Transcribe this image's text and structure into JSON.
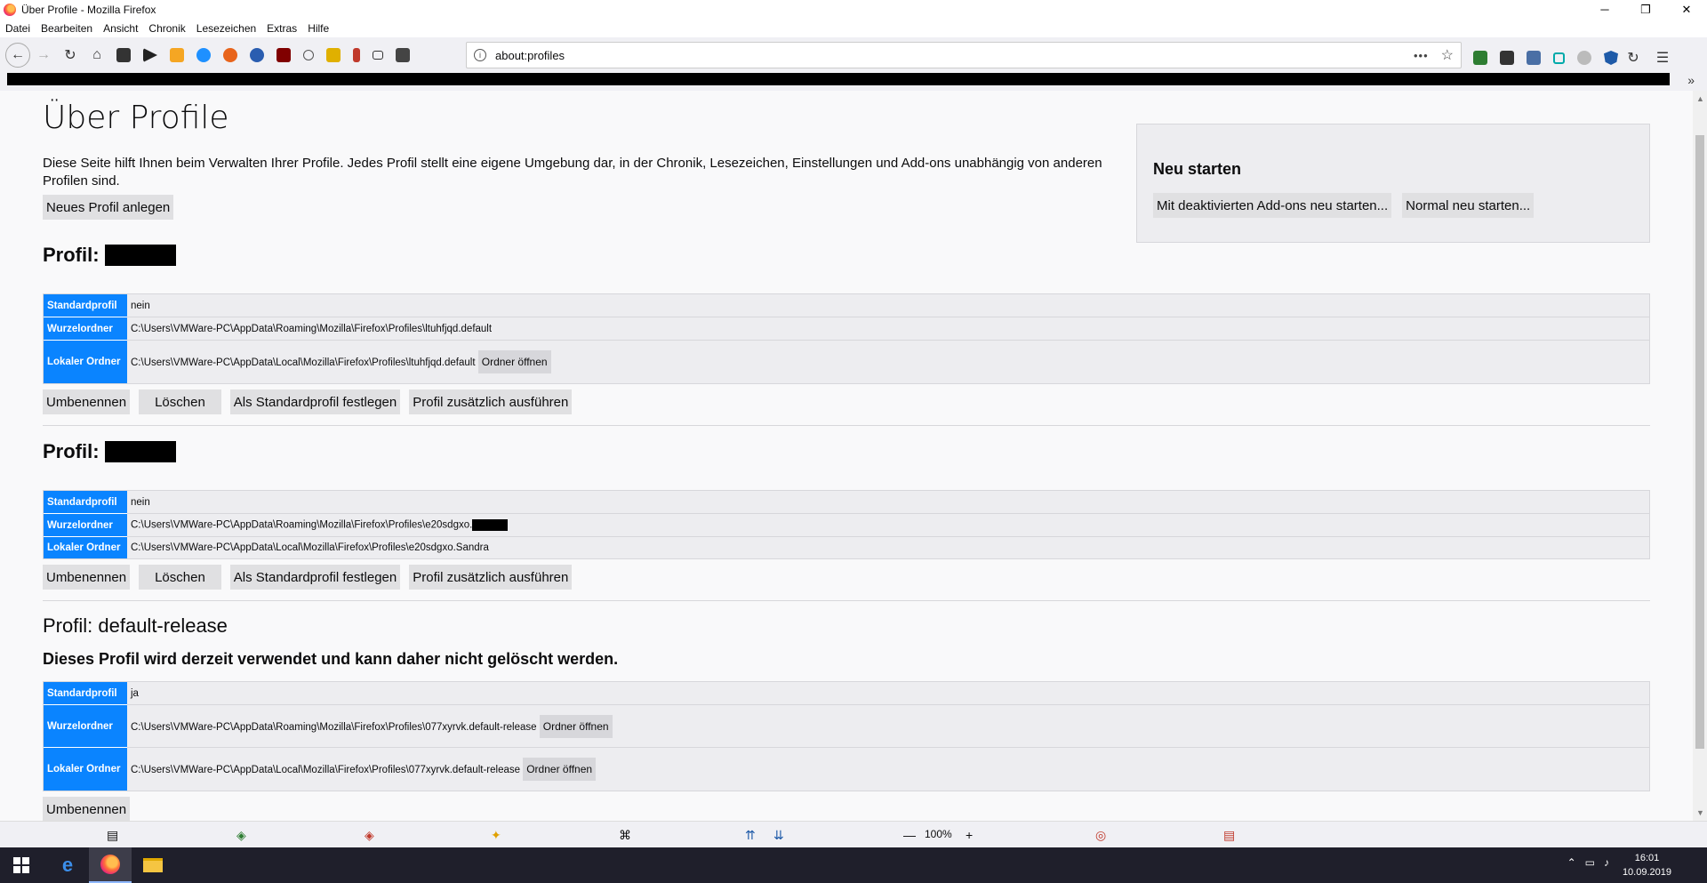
{
  "window": {
    "title": "Über Profile - Mozilla Firefox",
    "minimize": "─",
    "maximize": "❐",
    "close": "✕"
  },
  "menu": [
    "Datei",
    "Bearbeiten",
    "Ansicht",
    "Chronik",
    "Lesezeichen",
    "Extras",
    "Hilfe"
  ],
  "urlbar": {
    "url": "about:profiles",
    "info_glyph": "i",
    "more_glyph": "•••",
    "star_glyph": "☆"
  },
  "nav_icons": [
    "back-icon",
    "forward-icon",
    "reload-icon",
    "home-icon",
    "bookmark-icon",
    "arrow-icon",
    "home2-icon",
    "edge-icon",
    "addon-icon",
    "gear-icon",
    "ublock-icon",
    "circle-icon",
    "broom-icon",
    "battery-icon",
    "square-icon",
    "puzzle-icon"
  ],
  "page": {
    "title": "Über Profile",
    "intro": "Diese Seite hilft Ihnen beim Verwalten Ihrer Profile. Jedes Profil stellt eine eigene Umgebung dar, in der Chronik, Lesezeichen, Einstellungen und Add-ons unabhängig von anderen Profilen sind.",
    "new_profile": "Neues Profil anlegen",
    "restart": {
      "heading": "Neu starten",
      "safe_mode": "Mit deaktivierten Add-ons neu starten...",
      "normal": "Normal neu starten..."
    },
    "labels": {
      "profile_prefix": "Profil:",
      "default_profile": "Standardprofil",
      "root_dir": "Wurzelordner",
      "local_dir": "Lokaler Ordner",
      "open_folder": "Ordner öffnen",
      "rename": "Umbenennen",
      "remove": "Löschen",
      "set_default": "Als Standardprofil festlegen",
      "launch": "Profil zusätzlich ausführen"
    },
    "profiles": [
      {
        "name": "",
        "default": "nein",
        "root": "C:\\Users\\VMWare-PC\\AppData\\Roaming\\Mozilla\\Firefox\\Profiles\\ltuhfjqd.default",
        "local": "C:\\Users\\VMWare-PC\\AppData\\Local\\Mozilla\\Firefox\\Profiles\\ltuhfjqd.default"
      },
      {
        "name": "",
        "default": "nein",
        "root": "C:\\Users\\VMWare-PC\\AppData\\Roaming\\Mozilla\\Firefox\\Profiles\\e20sdgxo.",
        "local": "C:\\Users\\VMWare-PC\\AppData\\Local\\Mozilla\\Firefox\\Profiles\\e20sdgxo.Sandra"
      },
      {
        "name": "default-release",
        "notice": "Dieses Profil wird derzeit verwendet und kann daher nicht gelöscht werden.",
        "default": "ja",
        "root": "C:\\Users\\VMWare-PC\\AppData\\Roaming\\Mozilla\\Firefox\\Profiles\\077xyrvk.default-release",
        "local": "C:\\Users\\VMWare-PC\\AppData\\Local\\Mozilla\\Firefox\\Profiles\\077xyrvk.default-release"
      }
    ],
    "partial_button": "Umbenennen"
  },
  "statusbar": {
    "zoom": "100%",
    "zoom_out": "—",
    "zoom_in": "+"
  },
  "taskbar": {
    "time": "16:01",
    "date": "10.09.2019"
  },
  "colors": {
    "accent": "#0a84ff",
    "button": "#e0e0e2",
    "panel": "#ededf0"
  }
}
